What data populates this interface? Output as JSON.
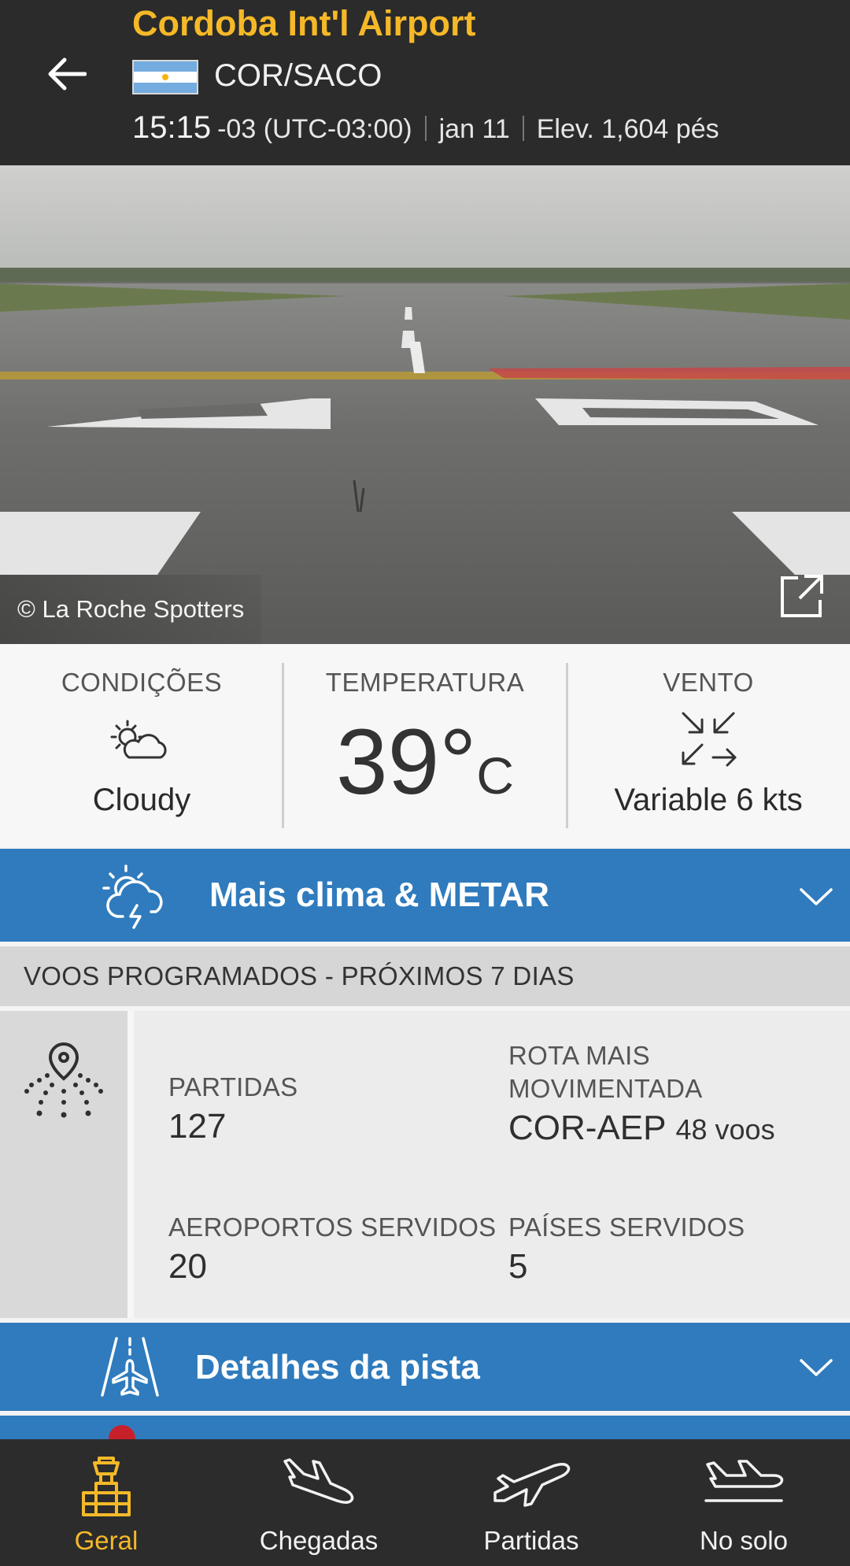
{
  "header": {
    "airport_name": "Cordoba Int'l Airport",
    "codes": "COR/SACO",
    "local_time": "15:15",
    "timezone": "-03 (UTC-03:00)",
    "date": "jan 11",
    "elevation": "Elev. 1,604 pés",
    "flag": "argentina-flag"
  },
  "photo": {
    "credit": "© La Roche Spotters",
    "open_icon": "external-link-icon"
  },
  "conditions": {
    "conditions_label": "CONDIÇÕES",
    "conditions_value": "Cloudy",
    "conditions_icon": "partly-cloudy-icon",
    "temperature_label": "TEMPERATURA",
    "temperature_value": "39°",
    "temperature_unit": "C",
    "wind_label": "VENTO",
    "wind_value": "Variable 6 kts",
    "wind_icon": "variable-wind-arrows-icon"
  },
  "weather_bar": {
    "title": "Mais clima & METAR",
    "icon": "storm-weather-icon"
  },
  "schedule": {
    "header": "VOOS PROGRAMADOS - PRÓXIMOS 7 DIAS",
    "icon": "location-routes-icon",
    "departures_label": "PARTIDAS",
    "departures_value": "127",
    "busiest_route_label": "ROTA MAIS MOVIMENTADA",
    "busiest_route_value": "COR-AEP",
    "busiest_route_flights": "48 voos",
    "airports_served_label": "AEROPORTOS SERVIDOS",
    "airports_served_value": "20",
    "countries_served_label": "PAÍSES SERVIDOS",
    "countries_served_value": "5"
  },
  "runway_bar": {
    "title": "Detalhes da pista",
    "icon": "runway-plane-icon"
  },
  "bottom_nav": {
    "items": [
      {
        "label": "Geral",
        "icon": "control-tower-icon",
        "active": true
      },
      {
        "label": "Chegadas",
        "icon": "arrival-plane-icon",
        "active": false
      },
      {
        "label": "Partidas",
        "icon": "departure-plane-icon",
        "active": false
      },
      {
        "label": "No solo",
        "icon": "plane-on-ground-icon",
        "active": false
      }
    ]
  },
  "colors": {
    "accent_yellow": "#f5b928",
    "bar_blue": "#2f7bbd",
    "header_dark": "#2b2b2b"
  }
}
